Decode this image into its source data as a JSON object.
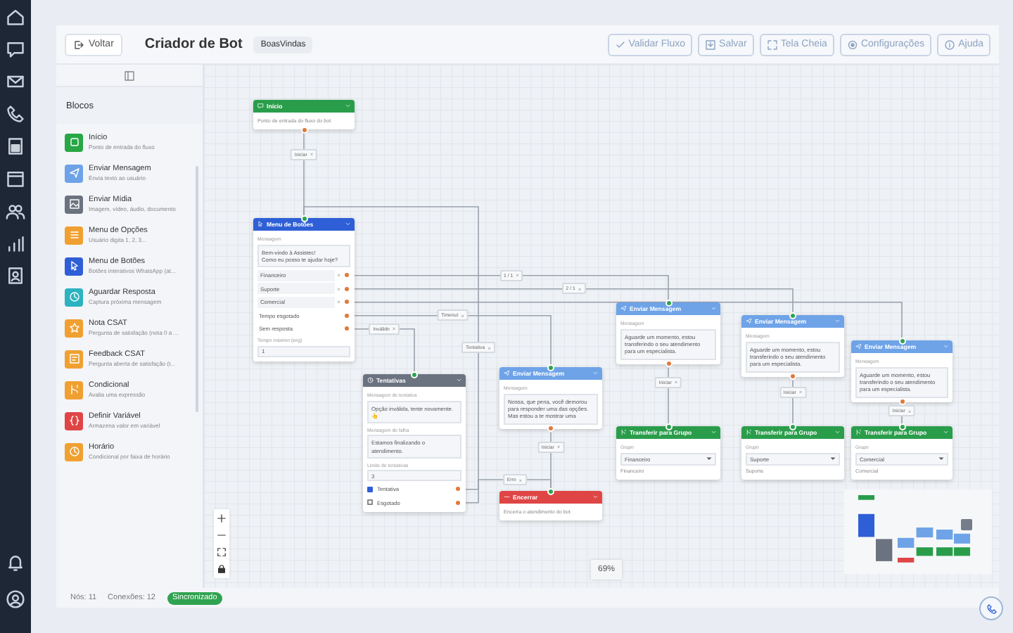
{
  "header": {
    "back": "Voltar",
    "title": "Criador de Bot",
    "flow_name": "BoasVindas",
    "actions": [
      "Validar Fluxo",
      "Salvar",
      "Tela Cheia",
      "Configurações",
      "Ajuda"
    ]
  },
  "sidebar": {
    "title": "Blocos",
    "items": [
      {
        "title": "Início",
        "description": "Ponto de entrada do fluxo",
        "color": "#28a745"
      },
      {
        "title": "Enviar Mensagem",
        "description": "Envia texto ao usuário",
        "color": "#6ea3e8"
      },
      {
        "title": "Enviar Mídia",
        "description": "Imagem, vídeo, áudio, documento",
        "color": "#6b7280"
      },
      {
        "title": "Menu de Opções",
        "description": "Usuário digita 1, 2, 3...",
        "color": "#f0a030"
      },
      {
        "title": "Menu de Botões",
        "description": "Botões interativos WhatsApp (at...",
        "color": "#2f5fd6"
      },
      {
        "title": "Aguardar Resposta",
        "description": "Captura próxima mensagem",
        "color": "#2bb3c0"
      },
      {
        "title": "Nota CSAT",
        "description": "Pergunta de satisfação (nota 0 a ...",
        "color": "#f0a030"
      },
      {
        "title": "Feedback CSAT",
        "description": "Pergunta aberta de satisfação (t...",
        "color": "#f0a030"
      },
      {
        "title": "Condicional",
        "description": "Avalia uma expressão",
        "color": "#f0a030"
      },
      {
        "title": "Definir Variável",
        "description": "Armazena valor em variável",
        "color": "#e04545"
      },
      {
        "title": "Horário",
        "description": "Condicional por faixa de horário",
        "color": "#f0a030"
      }
    ]
  },
  "canvas": {
    "nodes": [
      {
        "kind": "start",
        "title": "Início",
        "fields": [
          {
            "kind": "text",
            "text": "Ponto de entrada do fluxo do bot"
          }
        ]
      },
      {
        "kind": "buttons",
        "title": "Menu de Botões",
        "fields": [
          {
            "kind": "label",
            "text": "Mensagem"
          },
          {
            "kind": "textarea",
            "value": "Bem-vindo à Assistec!\nComo eu posso te ajudar hoje?"
          },
          {
            "kind": "option",
            "text": "Financeiro",
            "remove": "×"
          },
          {
            "kind": "option",
            "text": "Suporte",
            "remove": "×"
          },
          {
            "kind": "option",
            "text": "Comercial",
            "remove": "×"
          },
          {
            "kind": "output",
            "text": "Tempo esgotado"
          },
          {
            "kind": "output",
            "text": "Sem resposta"
          },
          {
            "kind": "label",
            "text": "Tempo máximo (seg)"
          },
          {
            "kind": "input",
            "value": "1"
          }
        ]
      },
      {
        "kind": "retry",
        "title": "Tentativas",
        "fields": [
          {
            "kind": "label",
            "text": "Mensagem de tentativa"
          },
          {
            "kind": "textarea",
            "value": "Opção inválida, tente novamente. 👆"
          },
          {
            "kind": "label",
            "text": "Mensagem de falha"
          },
          {
            "kind": "textarea",
            "value": "Estamos finalizando o atendimento."
          },
          {
            "kind": "label",
            "text": "Limite de tentativas"
          },
          {
            "kind": "input",
            "value": "3"
          },
          {
            "kind": "check",
            "text": "Tentativa",
            "checked": true
          },
          {
            "kind": "check",
            "text": "Esgotado",
            "checked": false
          }
        ]
      },
      {
        "kind": "message",
        "title": "Enviar Mensagem",
        "fields": [
          {
            "kind": "label",
            "text": "Mensagem"
          },
          {
            "kind": "textarea",
            "value": "Nossa, que pena, você demorou para responder uma das opções. Mas estou a te mostrar uma"
          }
        ]
      },
      {
        "kind": "end",
        "title": "Encerrar",
        "fields": [
          {
            "kind": "text",
            "text": "Encerra o atendimento do bot"
          }
        ]
      },
      {
        "kind": "message",
        "title": "Enviar Mensagem",
        "fields": [
          {
            "kind": "label",
            "text": "Mensagem"
          },
          {
            "kind": "textarea",
            "value": "Aguarde um momento, estou transferindo o seu atendimento para um especialista."
          }
        ]
      },
      {
        "kind": "message",
        "title": "Enviar Mensagem",
        "fields": [
          {
            "kind": "label",
            "text": "Mensagem"
          },
          {
            "kind": "textarea",
            "value": "Aguarde um momento, estou transferindo o seu atendimento para um especialista."
          }
        ]
      },
      {
        "kind": "message",
        "title": "Enviar Mensagem",
        "fields": [
          {
            "kind": "label",
            "text": "Mensagem"
          },
          {
            "kind": "textarea",
            "value": "Aguarde um momento, estou transferindo o seu atendimento para um especialista."
          }
        ]
      },
      {
        "kind": "transfer",
        "title": "Transferir para Grupo",
        "fields": [
          {
            "kind": "label",
            "text": "Grupo"
          },
          {
            "kind": "select",
            "value": "Financeiro"
          },
          {
            "kind": "text",
            "text": "Financeiro"
          }
        ]
      },
      {
        "kind": "transfer",
        "title": "Transferir para Grupo",
        "fields": [
          {
            "kind": "label",
            "text": "Grupo"
          },
          {
            "kind": "select",
            "value": "Suporte"
          },
          {
            "kind": "text",
            "text": "Suporte"
          }
        ]
      },
      {
        "kind": "transfer",
        "title": "Transferir para Grupo",
        "fields": [
          {
            "kind": "label",
            "text": "Grupo"
          },
          {
            "kind": "select",
            "value": "Comercial"
          },
          {
            "kind": "text",
            "text": "Comercial"
          }
        ]
      }
    ],
    "edges": [
      {
        "kind": "labeled",
        "label": "Iniciar",
        "remove": "×"
      },
      {
        "kind": "labeled",
        "label": "1 / 1",
        "remove": "×"
      },
      {
        "kind": "labeled",
        "label": "2 / 1",
        "remove": "×"
      },
      {
        "kind": "plain"
      },
      {
        "kind": "labeled",
        "label": "Timeout",
        "remove": "×"
      },
      {
        "kind": "labeled",
        "label": "Inválido",
        "remove": "×"
      },
      {
        "kind": "labeled",
        "label": "Tentativa",
        "remove": "×"
      },
      {
        "kind": "labeled",
        "label": "Erro",
        "remove": "×"
      },
      {
        "kind": "labeled",
        "label": "Iniciar",
        "remove": "×"
      },
      {
        "kind": "labeled",
        "label": "Iniciar",
        "remove": "×"
      },
      {
        "kind": "labeled",
        "label": "Iniciar",
        "remove": "×"
      },
      {
        "kind": "labeled",
        "label": "Iniciar",
        "remove": "×"
      }
    ],
    "zoom": "69%"
  },
  "status_bar": {
    "nodes": "Nós: 11",
    "connections": "Conexões: 12",
    "badge": "Sincronizado"
  }
}
